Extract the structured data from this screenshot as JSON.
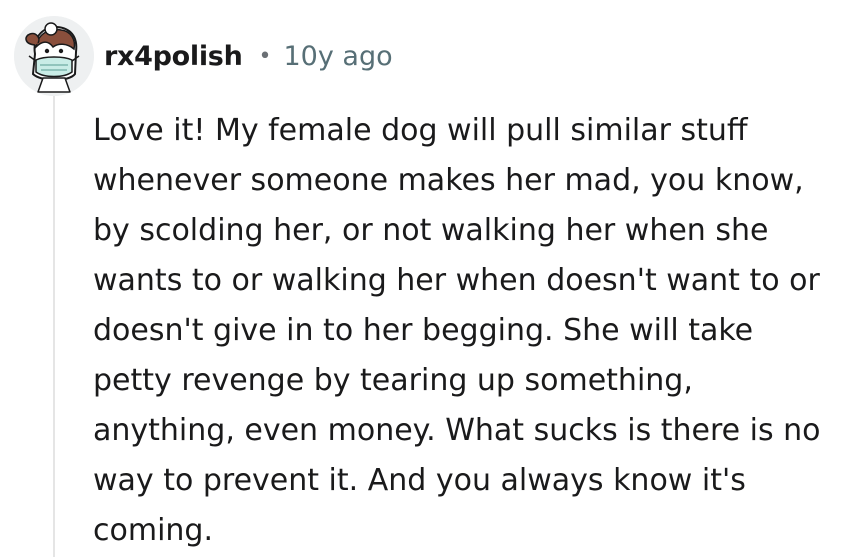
{
  "comment": {
    "author": "rx4polish",
    "separator": "•",
    "age": "10y ago",
    "body_lines": [
      "Love it! My female dog will pull similar stuff",
      "whenever someone makes her mad, you know,",
      "by scolding her, or not walking her when she",
      "wants to or walking her when doesn't want to or",
      "doesn't give in to her begging. She will take",
      "petty revenge by tearing up something,",
      "anything, even money. What sucks is there is no",
      "way to prevent it. And you always know it's",
      "coming."
    ],
    "avatar_icon": "snoo-avatar-with-face-mask-icon"
  },
  "colors": {
    "background": "#ffffff",
    "text": "#1a1a1b",
    "meta_text": "#576f76",
    "thread_line": "#e5e5e5"
  }
}
